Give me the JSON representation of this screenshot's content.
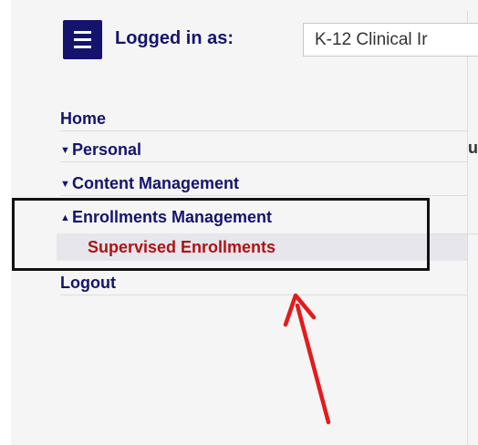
{
  "header": {
    "menu_icon": "hamburger-menu-icon",
    "logged_in_label": "Logged in as:",
    "user_role_value": "K-12 Clinical Ir"
  },
  "nav": {
    "home": "Home",
    "personal": "Personal",
    "content_management": "Content Management",
    "enrollments_management": "Enrollments Management",
    "supervised_enrollments": "Supervised Enrollments",
    "logout": "Logout",
    "caret_down": "▼",
    "caret_up": "▲"
  },
  "main": {
    "partial_heading": "u"
  },
  "annotation": {
    "box_color": "#111111",
    "arrow_color": "#e41b1b"
  },
  "colors": {
    "nav_text": "#14146e",
    "active_sub_text": "#b11212",
    "menu_button_bg": "#14146e"
  }
}
